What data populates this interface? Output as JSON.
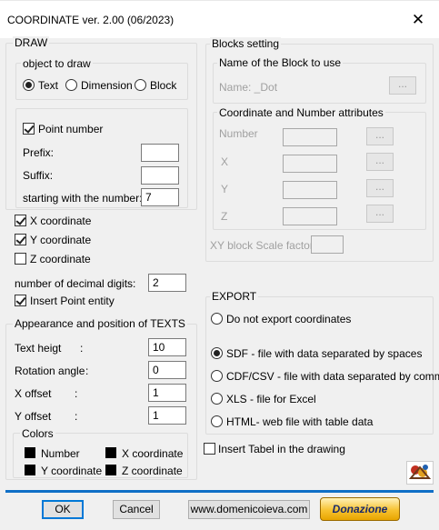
{
  "window": {
    "title": "COORDINATE ver. 2.00 (06/2023)",
    "close_glyph": "✕"
  },
  "draw": {
    "legend": "DRAW",
    "object_to_draw": {
      "legend": "object to draw",
      "options": [
        "Text",
        "Dimension",
        "Block"
      ],
      "selected": "Text"
    },
    "point_number": {
      "label": "Point number",
      "checked": true,
      "prefix_label": "Prefix:",
      "prefix_value": "",
      "suffix_label": "Suffix:",
      "suffix_value": "",
      "start_label": "starting with the number:",
      "start_value": "7"
    },
    "x_coordinate": {
      "label": "X coordinate",
      "checked": true
    },
    "y_coordinate": {
      "label": "Y coordinate",
      "checked": true
    },
    "z_coordinate": {
      "label": "Z coordinate",
      "checked": false
    },
    "decimal_digits_label": "number of decimal digits:",
    "decimal_digits_value": "2",
    "insert_point": {
      "label": "Insert Point entity",
      "checked": true
    }
  },
  "appearance": {
    "legend": "Appearance and position of TEXTS",
    "text_height_label": "Text heigt",
    "text_height_value": "10",
    "rotation_label": "Rotation angle",
    "rotation_value": "0",
    "x_offset_label": "X offset",
    "x_offset_value": "1",
    "y_offset_label": "Y offset",
    "y_offset_value": "1",
    "colon": ":",
    "colors": {
      "legend": "Colors",
      "number": "Number",
      "x_coordinate": "X coordinate",
      "y_coordinate": "Y coordinate",
      "z_coordinate": "Z coordinate",
      "swatch_color": "#000000"
    }
  },
  "blocks": {
    "legend": "Blocks setting",
    "name_group": {
      "legend": "Name of the Block to use",
      "name_label": "Name: _Dot",
      "button": "..."
    },
    "attributes": {
      "legend": "Coordinate and Number attributes",
      "rows": [
        {
          "label": "Number",
          "button": "..."
        },
        {
          "label": "X",
          "button": "..."
        },
        {
          "label": "Y",
          "button": "..."
        },
        {
          "label": "Z",
          "button": "..."
        }
      ]
    },
    "scale_label": "XY block Scale factor"
  },
  "export": {
    "legend": "EXPORT",
    "options": [
      "Do not export coordinates",
      "SDF - file with data separated by spaces",
      "CDF/CSV - file with data separated by commas",
      "XLS - file for Excel",
      "HTML- web file with table data"
    ],
    "selected_index": 1
  },
  "insert_table": {
    "label": "Insert Tabel in the drawing",
    "checked": false
  },
  "footer": {
    "ok": "OK",
    "cancel": "Cancel",
    "website": "www.domenicoieva.com",
    "donate": "Donazione",
    "accent_color": "#0f6fc6"
  }
}
